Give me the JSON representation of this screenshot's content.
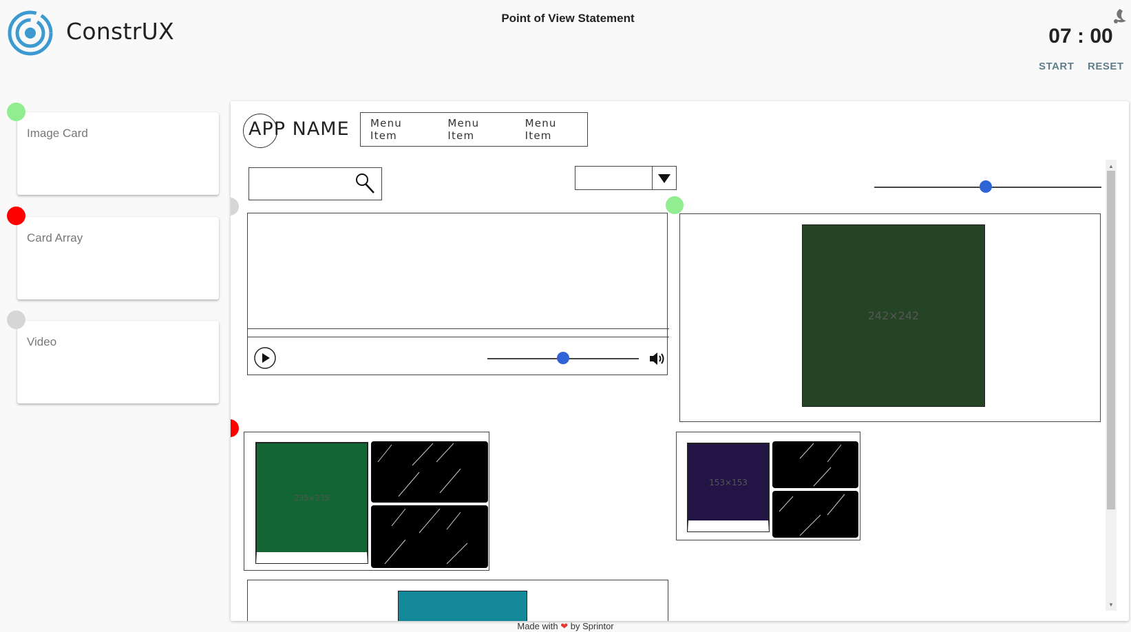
{
  "header": {
    "brand": "ConstrUX",
    "page_title": "Point of View Statement",
    "timer": "07 : 00",
    "start_label": "START",
    "reset_label": "RESET",
    "theme_icon": "night-mode-icon",
    "logo_color": "#3d9ad1"
  },
  "sidebar": {
    "items": [
      {
        "label": "Image Card",
        "status_color": "#90ee90"
      },
      {
        "label": "Card Array",
        "status_color": "#ff0000"
      },
      {
        "label": "Video",
        "status_color": "#d6d6d6"
      }
    ]
  },
  "canvas": {
    "app_name": "APP NAME",
    "menu_items": [
      "Menu Item",
      "Menu Item",
      "Menu Item"
    ],
    "search_placeholder": "",
    "dropdown_value": "",
    "top_slider_value": 0.49,
    "video": {
      "volume_value": 0.5
    },
    "image_card": {
      "image_label": "242×242",
      "image_color": "#254425"
    },
    "card_array_1": {
      "image_label": "235×235",
      "image_color": "#136534"
    },
    "card_array_2": {
      "image_label": "153×153",
      "image_color": "#221445"
    },
    "bottom_image_color": "#138898"
  },
  "footer": {
    "text_before": "Made with",
    "heart": "❤",
    "text_after": "by Sprintor"
  }
}
